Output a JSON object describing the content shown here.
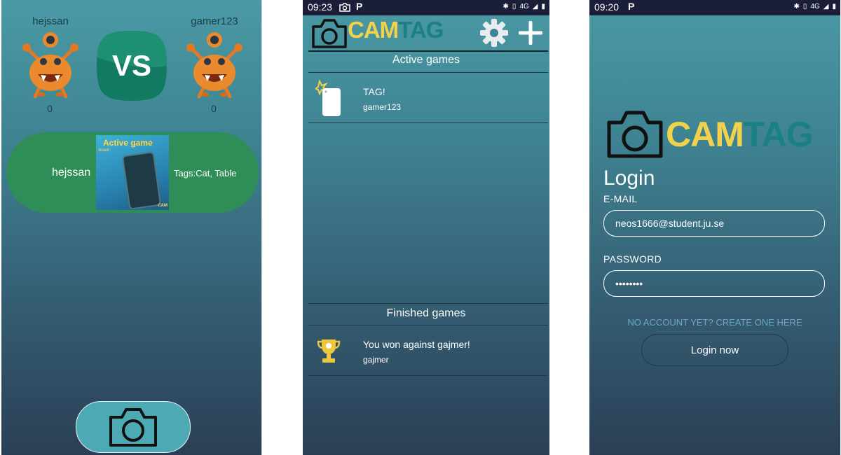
{
  "screen1": {
    "player1": {
      "name": "hejssan",
      "score": "0"
    },
    "player2": {
      "name": "gamer123",
      "score": "0"
    },
    "vs_label": "VS",
    "game_card": {
      "player": "hejssan",
      "tags": "Tags:Cat, Table",
      "thumbnail_title": "Active game",
      "thumbnail_subtitle": "board",
      "thumbnail_brand": "CAM"
    },
    "camera_button_icon": "camera-icon"
  },
  "screen2": {
    "status": {
      "time": "09:23",
      "network": "4G"
    },
    "logo": {
      "part1": "CAM",
      "part2": "TAG"
    },
    "toolbar_icons": [
      "gear-icon",
      "plus-icon"
    ],
    "active_section": "Active games",
    "active_games": [
      {
        "title": "TAG!",
        "subtitle": "gamer123",
        "icon": "phone-tag-icon"
      }
    ],
    "finished_section": "Finished games",
    "finished_games": [
      {
        "title": "You won against gajmer!",
        "subtitle": "gajmer",
        "icon": "trophy-icon"
      }
    ]
  },
  "screen3": {
    "status": {
      "time": "09:20",
      "network": "4G"
    },
    "logo": {
      "part1": "CAM",
      "part2": "TAG"
    },
    "title": "Login",
    "email_label": "E-MAIL",
    "email_value": "neos1666@student.ju.se",
    "password_label": "PASSWORD",
    "password_value": "••••••••",
    "create_account": "NO ACCOUNT YET? CREATE ONE HERE",
    "login_button": "Login now"
  },
  "colors": {
    "bg_top": "#4a9aa5",
    "bg_bottom": "#2a3f55",
    "card_green": "#2f8d58",
    "logo_yellow": "#f1d24a",
    "logo_teal": "#1b7f86",
    "status_bar": "#1b1e38"
  }
}
